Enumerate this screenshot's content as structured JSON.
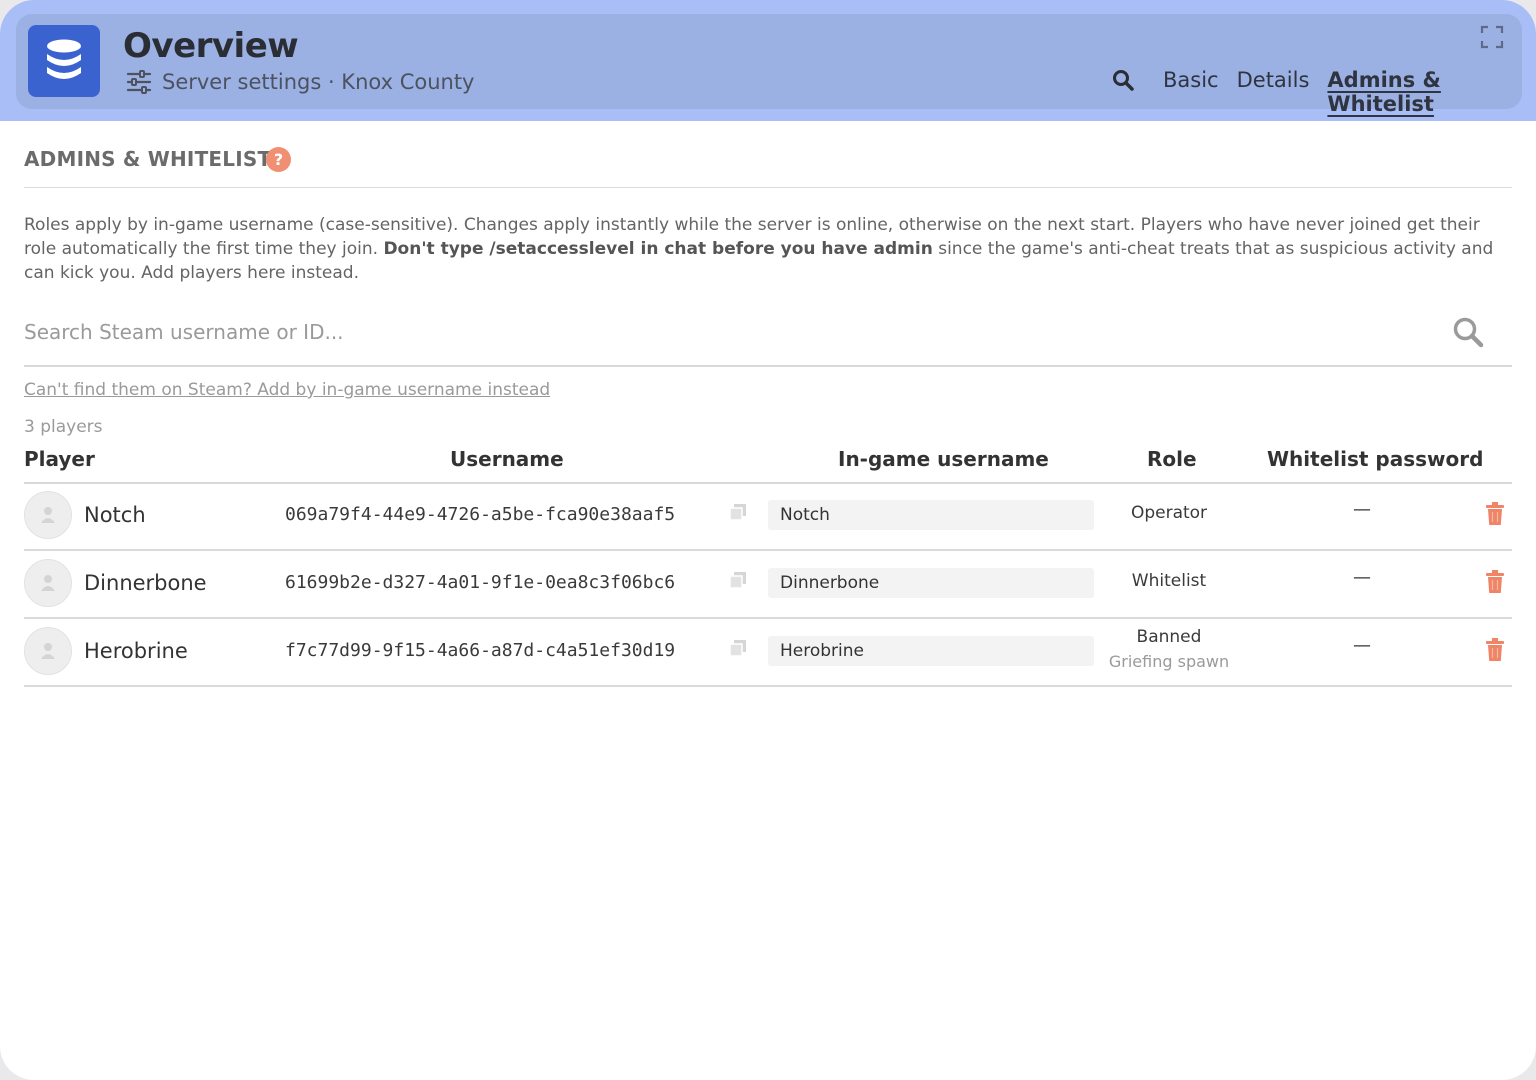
{
  "header": {
    "title": "Overview",
    "subtitle": "Server settings · Knox County",
    "tabs": [
      {
        "label": "Basic",
        "active": false
      },
      {
        "label": "Details",
        "active": false
      },
      {
        "label": "Admins & Whitelist",
        "active": true
      }
    ]
  },
  "section": {
    "title": "ADMINS & WHITELIST",
    "help": "?",
    "description_pre": "Roles apply by in-game username (case-sensitive). Changes apply instantly while the server is online, otherwise on the next start. Players who have never joined get their role automatically the first time they join. ",
    "description_bold": "Don't type /setaccesslevel in chat before you have admin",
    "description_post": " since the game's anti-cheat treats that as suspicious activity and can kick you. Add players here instead."
  },
  "search": {
    "placeholder": "Search Steam username or ID..."
  },
  "alt_link": "Can't find them on Steam? Add by in-game username instead",
  "player_count": "3 players",
  "table": {
    "columns": [
      "Player",
      "Username",
      "In-game username",
      "Role",
      "Whitelist password"
    ],
    "rows": [
      {
        "player": "Notch",
        "username": "069a79f4-44e9-4726-a5be-fca90e38aaf5",
        "ingame": "Notch",
        "role": "Operator",
        "role_note": "",
        "whitelist_password": "—"
      },
      {
        "player": "Dinnerbone",
        "username": "61699b2e-d327-4a01-9f1e-0ea8c3f06bc6",
        "ingame": "Dinnerbone",
        "role": "Whitelist",
        "role_note": "",
        "whitelist_password": "—"
      },
      {
        "player": "Herobrine",
        "username": "f7c77d99-9f15-4a66-a87d-c4a51ef30d19",
        "ingame": "Herobrine",
        "role": "Banned",
        "role_note": "Griefing spawn",
        "whitelist_password": "—"
      }
    ]
  },
  "icons": {
    "app": "database-icon",
    "subtitle": "sliders-icon",
    "expand": "expand-icon",
    "search": "search-icon",
    "help": "help-icon",
    "copy": "copy-icon",
    "delete": "trash-icon",
    "avatar": "user-icon"
  },
  "colors": {
    "header_band": "#a9bdf6",
    "header_card": "#9bb0e3",
    "app_icon": "#3b63cf",
    "accent_danger": "#ef8566"
  }
}
